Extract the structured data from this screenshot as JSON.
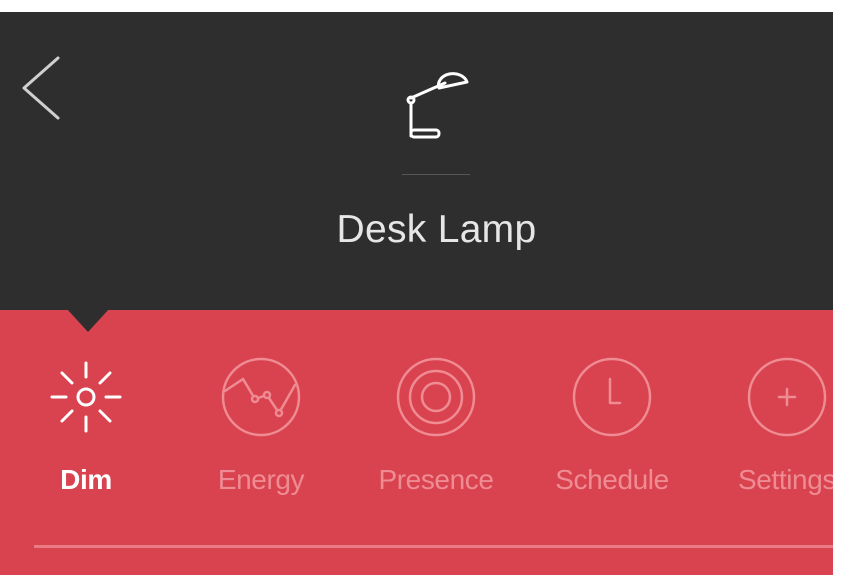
{
  "header": {
    "back_icon": "chevron-left-icon",
    "device_icon": "desk-lamp-icon",
    "device_name": "Desk Lamp"
  },
  "tabs": [
    {
      "label": "Dim",
      "icon": "sun-dim-icon",
      "active": true
    },
    {
      "label": "Energy",
      "icon": "energy-graph-icon",
      "active": false
    },
    {
      "label": "Presence",
      "icon": "presence-target-icon",
      "active": false
    },
    {
      "label": "Schedule",
      "icon": "clock-icon",
      "active": false
    },
    {
      "label": "Settings",
      "icon": "plus-icon",
      "active": false
    }
  ],
  "colors": {
    "header_bg": "#2e2e2e",
    "accent": "#d9434f",
    "inactive_tab": "#ef8b93",
    "active_tab": "#ffffff",
    "device_name": "#e6e6e6"
  }
}
